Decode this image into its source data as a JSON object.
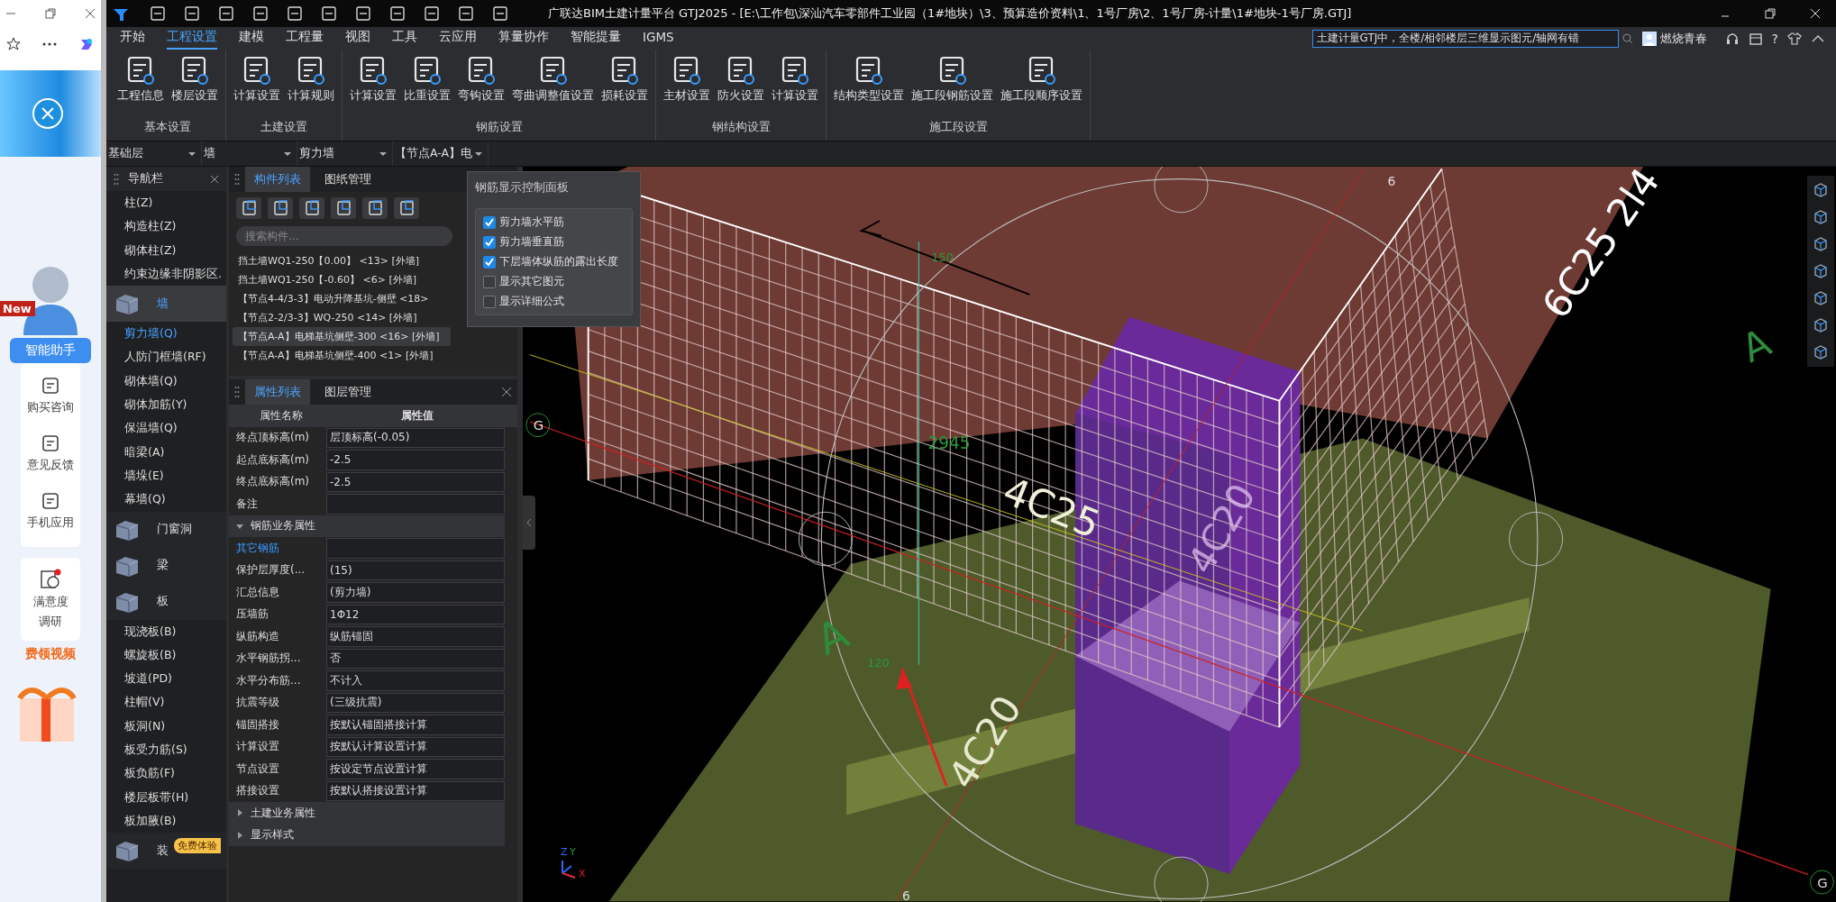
{
  "browser_sidebar": {
    "badge": "New",
    "assistant": "智能助手",
    "services": [
      "购买咨询",
      "意见反馈",
      "手机应用"
    ],
    "survey": [
      "满意度",
      "调研"
    ],
    "promo": "费领视频"
  },
  "window": {
    "title": "广联达BIM土建计量平台 GTJ2025 - [E:\\工作包\\深汕汽车零部件工业园（1#地块）\\3、预算造价资料\\1、1号厂房\\2、1号厂房-计量\\1#地块-1号厂房.GTJ]"
  },
  "menu": {
    "tabs": [
      {
        "label": "开始",
        "selected": false
      },
      {
        "label": "工程设置",
        "selected": true
      },
      {
        "label": "建模",
        "selected": false
      },
      {
        "label": "工程量",
        "selected": false
      },
      {
        "label": "视图",
        "selected": false
      },
      {
        "label": "工具",
        "selected": false
      },
      {
        "label": "云应用",
        "selected": false
      },
      {
        "label": "算量协作",
        "selected": false
      },
      {
        "label": "智能提量",
        "selected": false
      },
      {
        "label": "IGMS",
        "selected": false
      }
    ]
  },
  "search": {
    "value": "土建计量GTJ中，全楼/相邻楼层三维显示图元/轴网有错"
  },
  "user": {
    "name": "燃烧青春"
  },
  "help": "?",
  "ribbon": {
    "groups": [
      {
        "label": "基本设置",
        "buttons": [
          "工程信息",
          "楼层设置"
        ]
      },
      {
        "label": "土建设置",
        "buttons": [
          "计算设置",
          "计算规则"
        ]
      },
      {
        "label": "钢筋设置",
        "buttons": [
          "计算设置",
          "比重设置",
          "弯钩设置",
          "弯曲调整值设置",
          "损耗设置"
        ]
      },
      {
        "label": "钢结构设置",
        "buttons": [
          "主材设置",
          "防火设置",
          "计算设置"
        ]
      },
      {
        "label": "施工段设置",
        "buttons": [
          "结构类型设置",
          "施工段钢筋设置",
          "施工段顺序设置"
        ]
      }
    ]
  },
  "selectors": [
    "基础层",
    "墙",
    "剪力墙",
    "【节点A-A】电"
  ],
  "nav": {
    "title": "导航栏",
    "items": [
      {
        "kind": "item",
        "label": "柱(Z)",
        "selected": false
      },
      {
        "kind": "item",
        "label": "构造柱(Z)",
        "selected": false
      },
      {
        "kind": "item",
        "label": "砌体柱(Z)",
        "selected": false
      },
      {
        "kind": "item",
        "label": "约束边缘非阴影区.",
        "selected": false
      },
      {
        "kind": "category",
        "label": "墙",
        "selected": true,
        "expanded": true,
        "children": [
          {
            "label": "剪力墙(Q)",
            "selected": true
          },
          {
            "label": "人防门框墙(RF)",
            "selected": false
          },
          {
            "label": "砌体墙(Q)",
            "selected": false
          },
          {
            "label": "砌体加筋(Y)",
            "selected": false
          },
          {
            "label": "保温墙(Q)",
            "selected": false
          },
          {
            "label": "暗梁(A)",
            "selected": false
          },
          {
            "label": "墙垛(E)",
            "selected": false
          },
          {
            "label": "幕墙(Q)",
            "selected": false
          }
        ]
      },
      {
        "kind": "category",
        "label": "门窗洞",
        "selected": false
      },
      {
        "kind": "category",
        "label": "梁",
        "selected": false
      },
      {
        "kind": "category",
        "label": "板",
        "selected": false,
        "expanded": true,
        "children": [
          {
            "label": "现浇板(B)",
            "selected": false
          },
          {
            "label": "螺旋板(B)",
            "selected": false
          },
          {
            "label": "坡道(PD)",
            "selected": false
          },
          {
            "label": "柱帽(V)",
            "selected": false
          },
          {
            "label": "板洞(N)",
            "selected": false
          },
          {
            "label": "板受力筋(S)",
            "selected": false
          },
          {
            "label": "板负筋(F)",
            "selected": false
          },
          {
            "label": "楼层板带(H)",
            "selected": false
          },
          {
            "label": "板加腋(B)",
            "selected": false
          }
        ]
      },
      {
        "kind": "category",
        "label": "装",
        "selected": false,
        "badge": "免费体验"
      }
    ]
  },
  "component_panel": {
    "tabs": [
      {
        "label": "构件列表",
        "selected": true
      },
      {
        "label": "图纸管理",
        "selected": false
      }
    ],
    "placeholder": "搜索构件...",
    "items": [
      {
        "label": "挡土墙WQ1-250【0.00】 <13> [外墙]",
        "selected": false
      },
      {
        "label": "挡土墙WQ1-250【-0.60】 <6> [外墙]",
        "selected": false
      },
      {
        "label": "【节点4-4/3-3】电动升降基坑-侧壁 <18>",
        "selected": false
      },
      {
        "label": "【节点2-2/3-3】WQ-250 <14> [外墙]",
        "selected": false
      },
      {
        "label": "【节点A-A】电梯基坑侧壁-300 <16> [外墙]",
        "selected": true
      },
      {
        "label": "【节点A-A】电梯基坑侧壁-400 <1> [外墙]",
        "selected": false
      }
    ]
  },
  "property_panel": {
    "tabs": [
      {
        "label": "属性列表",
        "selected": true
      },
      {
        "label": "图层管理",
        "selected": false
      }
    ],
    "columns": [
      "属性名称",
      "属性值"
    ],
    "rows": [
      {
        "kind": "property",
        "name": "终点顶标高(m)",
        "value": "层顶标高(-0.05)"
      },
      {
        "kind": "property",
        "name": "起点底标高(m)",
        "value": "-2.5"
      },
      {
        "kind": "property",
        "name": "终点底标高(m)",
        "value": "-2.5"
      },
      {
        "kind": "property",
        "name": "备注"
      },
      {
        "kind": "section",
        "name": "钢筋业务属性",
        "expanded": true
      },
      {
        "kind": "link",
        "name": "其它钢筋"
      },
      {
        "kind": "property",
        "name": "保护层厚度(...",
        "value": "(15)"
      },
      {
        "kind": "property",
        "name": "汇总信息",
        "value": "(剪力墙)"
      },
      {
        "kind": "property",
        "name": "压墙筋",
        "value": "1Φ12"
      },
      {
        "kind": "property",
        "name": "纵筋构造",
        "value": "纵筋锚固"
      },
      {
        "kind": "property",
        "name": "水平钢筋拐...",
        "value": "否"
      },
      {
        "kind": "property",
        "name": "水平分布筋...",
        "value": "不计入"
      },
      {
        "kind": "property",
        "name": "抗震等级",
        "value": "(三级抗震)"
      },
      {
        "kind": "property",
        "name": "锚固搭接",
        "value": "按默认锚固搭接计算"
      },
      {
        "kind": "property",
        "name": "计算设置",
        "value": "按默认计算设置计算"
      },
      {
        "kind": "property",
        "name": "节点设置",
        "value": "按设定节点设置计算"
      },
      {
        "kind": "property",
        "name": "搭接设置",
        "value": "按默认搭接设置计算"
      },
      {
        "kind": "section",
        "name": "土建业务属性",
        "expanded": false
      },
      {
        "kind": "section",
        "name": "显示样式",
        "expanded": false
      }
    ]
  },
  "rebar_panel": {
    "title": "钢筋显示控制面板",
    "options": [
      {
        "label": "剪力墙水平筋",
        "checked": true
      },
      {
        "label": "剪力墙垂直筋",
        "checked": true
      },
      {
        "label": "下层墙体纵筋的露出长度",
        "checked": true
      },
      {
        "label": "显示其它图元",
        "checked": false
      },
      {
        "label": "显示详细公式",
        "checked": false
      }
    ]
  },
  "view": {
    "labels": [
      "6",
      "150",
      "6C25 2l4",
      "A",
      "G",
      "2945",
      "4C25",
      "4C20",
      "A",
      "120",
      "4C20",
      "G",
      "6"
    ],
    "axis_labels": [
      "Z",
      "Y",
      "X"
    ]
  }
}
